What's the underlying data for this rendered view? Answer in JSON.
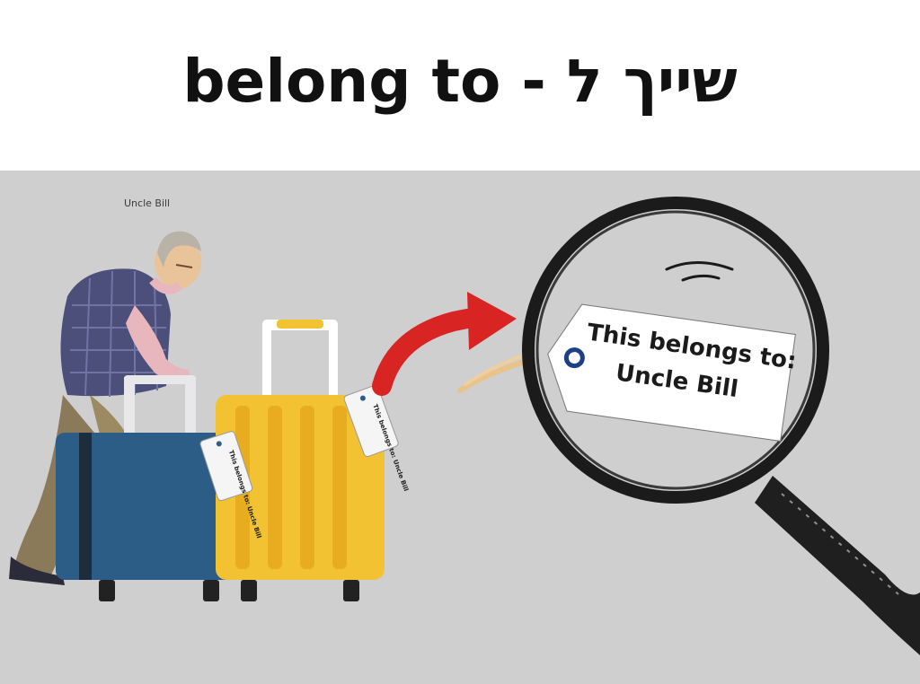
{
  "header": {
    "title": "belong to - שייך ל"
  },
  "scene": {
    "person_label": "Uncle Bill",
    "magnified_tag": {
      "line1": "This belongs to:",
      "line2": "Uncle Bill"
    },
    "small_tag_1": "This belongs to: Uncle Bill",
    "small_tag_2": "This belongs to: Uncle Bill"
  },
  "colors": {
    "background": "#cfcfd0",
    "blue_suitcase": "#2b5d86",
    "yellow_suitcase": "#f3c233",
    "arrow": "#d92424"
  }
}
